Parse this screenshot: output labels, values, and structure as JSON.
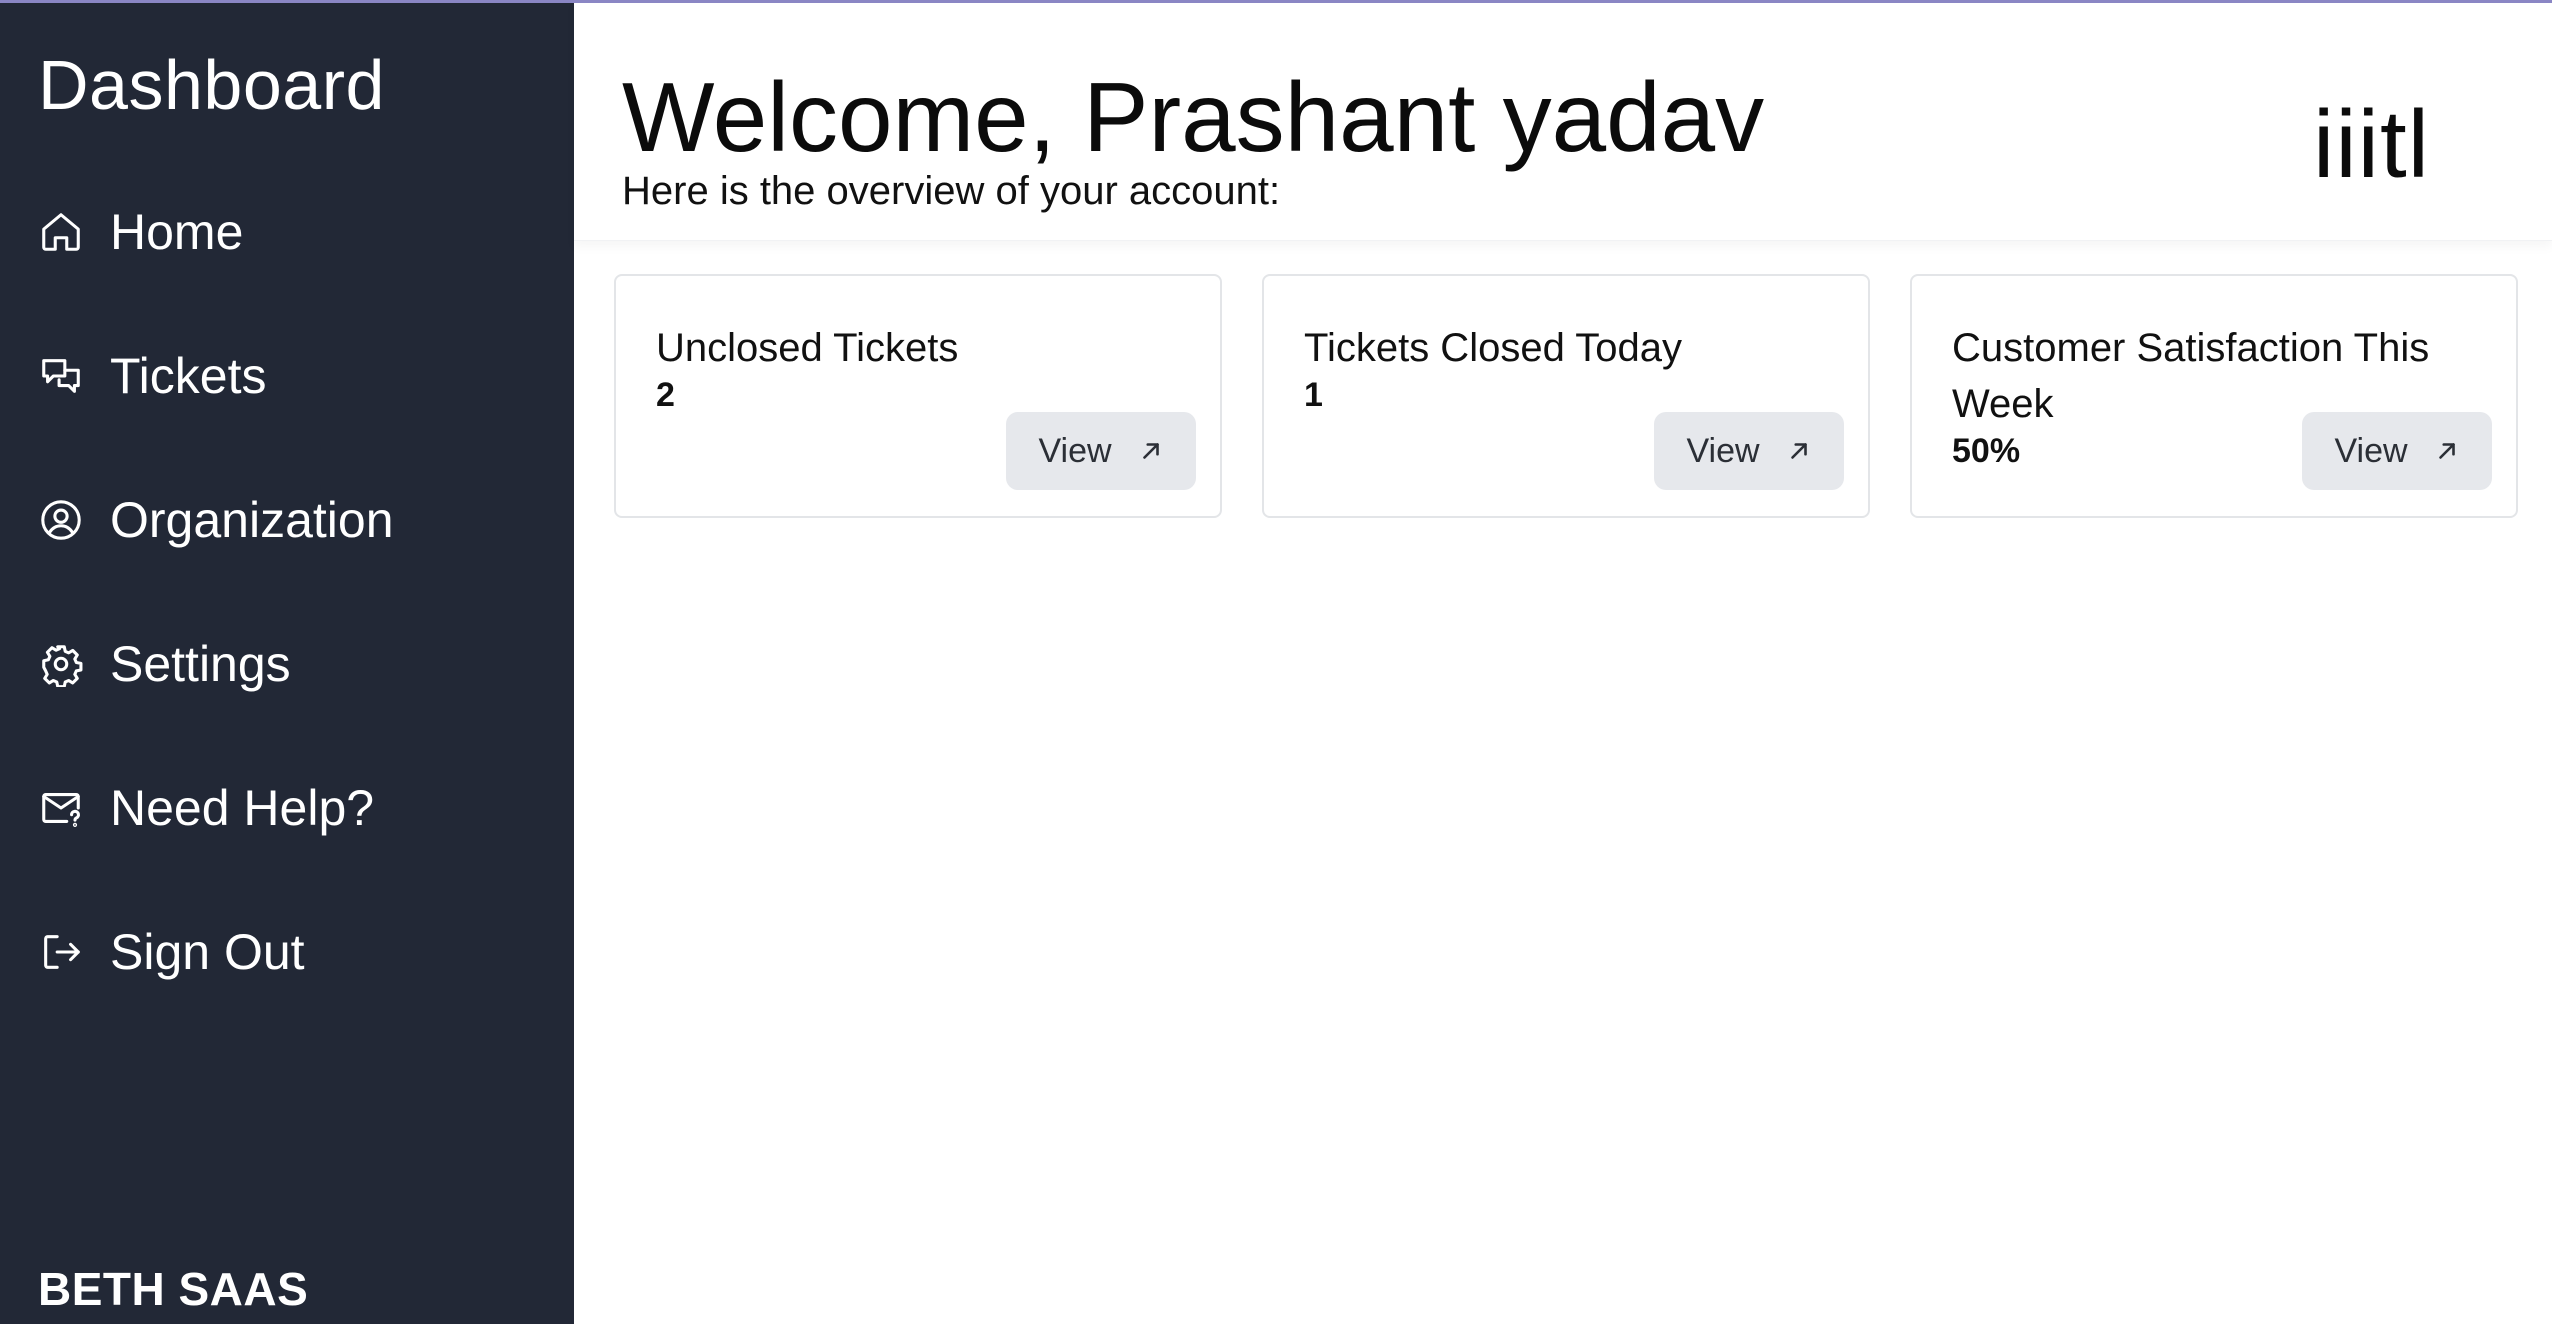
{
  "sidebar": {
    "title": "Dashboard",
    "items": [
      {
        "label": "Home",
        "icon": "home-icon"
      },
      {
        "label": "Tickets",
        "icon": "chat-bubbles-icon"
      },
      {
        "label": "Organization",
        "icon": "user-circle-icon"
      },
      {
        "label": "Settings",
        "icon": "gear-icon"
      },
      {
        "label": "Need Help?",
        "icon": "mail-question-icon"
      },
      {
        "label": "Sign Out",
        "icon": "sign-out-icon"
      }
    ],
    "brand": "BETH SAAS"
  },
  "header": {
    "welcome": "Welcome, Prashant yadav",
    "subtitle": "Here is the overview of your account:",
    "org_logo": "iiitl"
  },
  "cards": [
    {
      "title": "Unclosed Tickets",
      "value": "2",
      "button": "View"
    },
    {
      "title": "Tickets Closed Today",
      "value": "1",
      "button": "View"
    },
    {
      "title": "Customer Satisfaction This Week",
      "value": "50%",
      "button": "View"
    }
  ],
  "colors": {
    "sidebar_bg": "#222836",
    "accent_line": "#8a86c4",
    "button_bg": "#e6e8ec",
    "card_border": "#e3e5e8"
  }
}
